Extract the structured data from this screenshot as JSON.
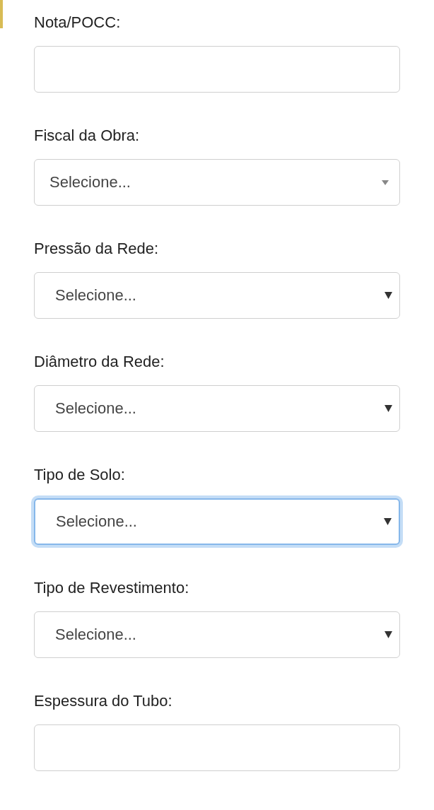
{
  "fields": [
    {
      "label": "Nota/POCC:",
      "kind": "text",
      "focused": false
    },
    {
      "label": "Fiscal da Obra:",
      "kind": "searchable_select",
      "value": "Selecione...",
      "focused": false
    },
    {
      "label": "Pressão da Rede:",
      "kind": "select",
      "value": "Selecione...",
      "focused": false
    },
    {
      "label": "Diâmetro da Rede:",
      "kind": "select",
      "value": "Selecione...",
      "focused": false
    },
    {
      "label": "Tipo de Solo:",
      "kind": "select",
      "value": "Selecione...",
      "focused": true
    },
    {
      "label": "Tipo de Revestimento:",
      "kind": "select",
      "value": "Selecione...",
      "focused": false
    },
    {
      "label": "Espessura do Tubo:",
      "kind": "text",
      "focused": false
    }
  ]
}
